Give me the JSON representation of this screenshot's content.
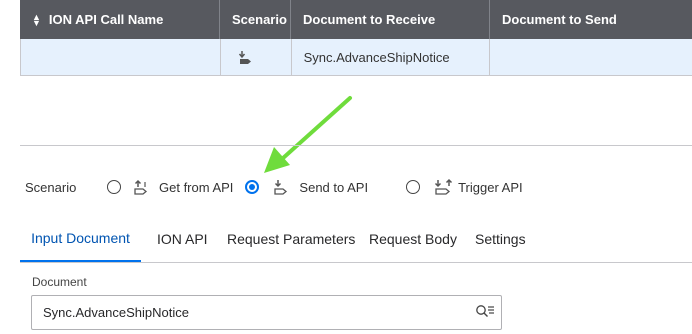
{
  "grid": {
    "headers": {
      "call_name": "ION API Call Name",
      "scenario": "Scenario",
      "receive": "Document to Receive",
      "send": "Document to Send"
    },
    "row": {
      "call_name": "",
      "scenario_icon": "send-to-api-icon",
      "receive": "Sync.AdvanceShipNotice",
      "send": ""
    }
  },
  "scenario": {
    "label": "Scenario",
    "options": [
      {
        "label": "Get from API",
        "icon": "get-from-api-icon",
        "selected": false
      },
      {
        "label": "Send to API",
        "icon": "send-to-api-icon",
        "selected": true
      },
      {
        "label": "Trigger API",
        "icon": "trigger-api-icon",
        "selected": false
      }
    ]
  },
  "tabs": [
    {
      "label": "Input Document",
      "active": true
    },
    {
      "label": "ION API",
      "active": false
    },
    {
      "label": "Request Parameters",
      "active": false
    },
    {
      "label": "Request Body",
      "active": false
    },
    {
      "label": "Settings",
      "active": false
    }
  ],
  "document": {
    "label": "Document",
    "value": "Sync.AdvanceShipNotice",
    "lookup_icon": "lookup-icon"
  },
  "annotation": {
    "color": "#6fdc3c",
    "icon": "green-arrow-annotation"
  },
  "colors": {
    "accent": "#0072ed",
    "header_bg": "#57595f",
    "selected_row": "#e6f1fd"
  }
}
